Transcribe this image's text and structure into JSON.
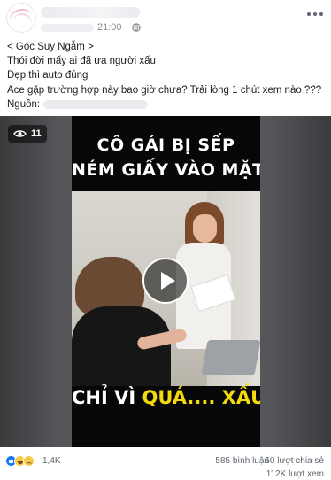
{
  "post": {
    "time": "21:00",
    "meta_separator": "·",
    "text_lines": [
      "< Góc Suy Ngẫm >",
      "Thói đời mấy ai đã ưa người xấu",
      "Đẹp thì auto đúng",
      "Ace gặp trường hợp này bao giờ chưa? Trải lòng 1 chút xem nào ???"
    ],
    "source_label": "Nguồn:"
  },
  "video": {
    "view_count": "11",
    "headline_line1": "CÔ GÁI BỊ SẾP",
    "headline_line2": "NÉM GIẤY VÀO MẶT",
    "caption_prefix": "CHỈ VÌ",
    "caption_highlight": "QUÁ....",
    "caption_suffix": "XẤU!!!",
    "highlight_color": "#f5d90a"
  },
  "footer": {
    "reactions_count": "1,4K",
    "comments": "585 bình luận",
    "shares": "60 lượt chia sẻ",
    "views": "112K lượt xem"
  },
  "icons": {
    "privacy": "globe-icon",
    "menu": "more-options-icon",
    "views": "eye-icon",
    "play": "play-icon",
    "reactions": [
      "like-reaction-icon",
      "haha-reaction-icon",
      "sad-reaction-icon"
    ]
  }
}
